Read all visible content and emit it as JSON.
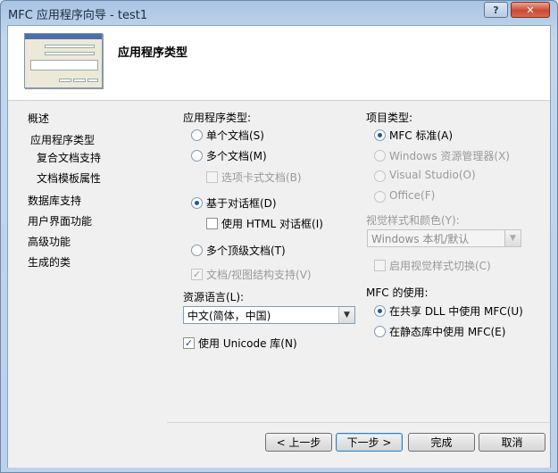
{
  "window": {
    "title": "MFC 应用程序向导 - test1",
    "help_label": "?",
    "close_label": "✕"
  },
  "header": {
    "title": "应用程序类型"
  },
  "nav": {
    "items": [
      {
        "label": "概述"
      },
      {
        "label": "应用程序类型"
      },
      {
        "label": "复合文档支持"
      },
      {
        "label": "文档模板属性"
      },
      {
        "label": "数据库支持"
      },
      {
        "label": "用户界面功能"
      },
      {
        "label": "高级功能"
      },
      {
        "label": "生成的类"
      }
    ]
  },
  "app_type": {
    "heading": "应用程序类型:",
    "single_doc": "单个文档(S)",
    "multi_doc": "多个文档(M)",
    "tabbed_docs": "选项卡式文档(B)",
    "dialog_based": "基于对话框(D)",
    "html_dialog": "使用 HTML 对话框(I)",
    "multi_top": "多个顶级文档(T)",
    "doc_view": "文档/视图结构支持(V)",
    "selected": "dialog_based"
  },
  "language": {
    "heading": "资源语言(L):",
    "value": "中文(简体，中国)"
  },
  "unicode": {
    "label": "使用 Unicode 库(N)",
    "checked": true
  },
  "project_type": {
    "heading": "项目类型:",
    "mfc_standard": "MFC 标准(A)",
    "explorer": "Windows 资源管理器(X)",
    "visual_studio": "Visual Studio(O)",
    "office": "Office(F)",
    "selected": "mfc_standard"
  },
  "visual_style": {
    "heading": "视觉样式和颜色(Y):",
    "value": "Windows 本机/默认",
    "toggle_label": "启用视觉样式切换(C)"
  },
  "mfc_use": {
    "heading": "MFC 的使用:",
    "shared": "在共享 DLL 中使用 MFC(U)",
    "static": "在静态库中使用 MFC(E)",
    "selected": "shared"
  },
  "buttons": {
    "prev": "< 上一步",
    "next": "下一步 >",
    "finish": "完成",
    "cancel": "取消"
  },
  "colors": {
    "accent": "#1c57a8",
    "disabled_text": "#9a9a9a"
  }
}
